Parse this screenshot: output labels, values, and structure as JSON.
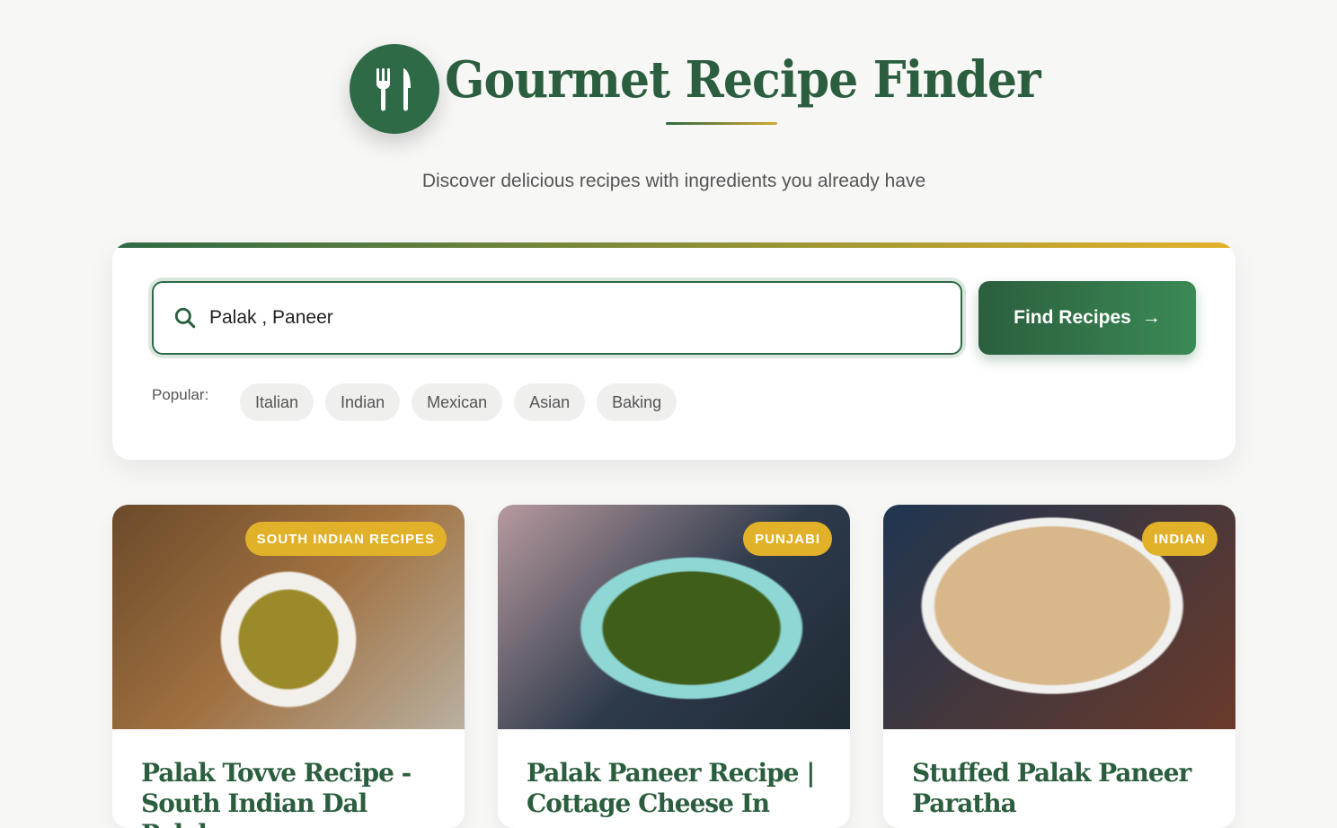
{
  "header": {
    "title": "Gourmet Recipe Finder",
    "subtitle": "Discover delicious recipes with ingredients you already have"
  },
  "search": {
    "value": "Palak , Paneer",
    "button": "Find Recipes",
    "popular_label": "Popular:",
    "chips": [
      "Italian",
      "Indian",
      "Mexican",
      "Asian",
      "Baking"
    ]
  },
  "recipes": [
    {
      "badge": "SOUTH INDIAN RECIPES",
      "title": "Palak Tovve Recipe - South Indian Dal Palak"
    },
    {
      "badge": "PUNJABI",
      "title": "Palak Paneer Recipe | Cottage Cheese In"
    },
    {
      "badge": "INDIAN",
      "title": "Stuffed Palak Paneer Paratha"
    }
  ]
}
